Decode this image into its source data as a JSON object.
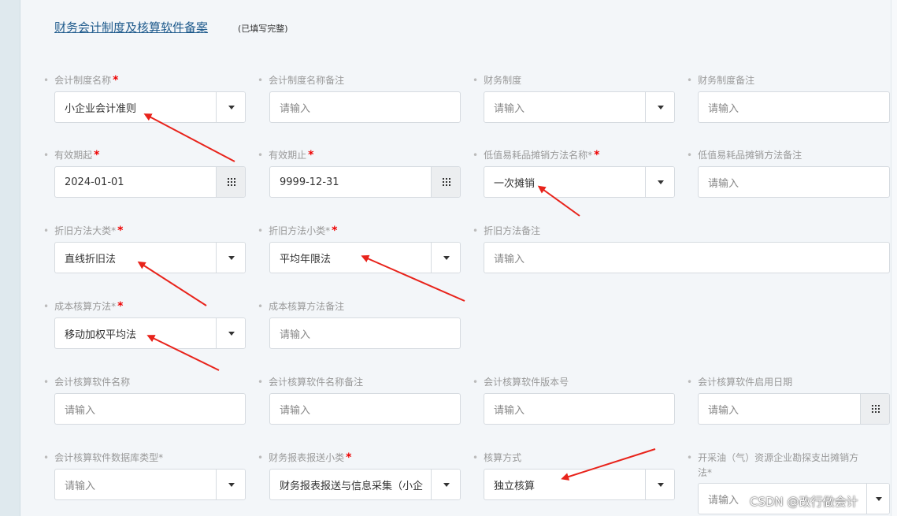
{
  "section": {
    "title": "财务会计制度及核算软件备案",
    "note": "(已填写完整)"
  },
  "fields": {
    "r1c1": {
      "label": "会计制度名称",
      "required": "*",
      "value": "小企业会计准则"
    },
    "r1c2": {
      "label": "会计制度名称备注",
      "placeholder": "请输入"
    },
    "r1c3": {
      "label": "财务制度",
      "placeholder": "请输入"
    },
    "r1c4": {
      "label": "财务制度备注",
      "placeholder": "请输入"
    },
    "r2c1": {
      "label": "有效期起",
      "required": "*",
      "value": "2024-01-01"
    },
    "r2c2": {
      "label": "有效期止",
      "required": "*",
      "value": "9999-12-31"
    },
    "r2c3": {
      "label": "低值易耗品摊销方法名称*",
      "required": "*",
      "value": "一次摊销"
    },
    "r2c4": {
      "label": "低值易耗品摊销方法备注",
      "placeholder": "请输入"
    },
    "r3c1": {
      "label": "折旧方法大类*",
      "required": "*",
      "value": "直线折旧法"
    },
    "r3c2": {
      "label": "折旧方法小类*",
      "required": "*",
      "value": "平均年限法"
    },
    "r3c3": {
      "label": "折旧方法备注",
      "placeholder": "请输入"
    },
    "r4c1": {
      "label": "成本核算方法*",
      "required": "*",
      "value": "移动加权平均法"
    },
    "r4c2": {
      "label": "成本核算方法备注",
      "placeholder": "请输入"
    },
    "r5c1": {
      "label": "会计核算软件名称",
      "placeholder": "请输入"
    },
    "r5c2": {
      "label": "会计核算软件名称备注",
      "placeholder": "请输入"
    },
    "r5c3": {
      "label": "会计核算软件版本号",
      "placeholder": "请输入"
    },
    "r5c4": {
      "label": "会计核算软件启用日期",
      "placeholder": "请输入"
    },
    "r6c1": {
      "label": "会计核算软件数据库类型*",
      "placeholder": "请输入"
    },
    "r6c2": {
      "label": "财务报表报送小类",
      "required": "*",
      "value": "财务报表报送与信息采集（小企"
    },
    "r6c3": {
      "label": "核算方式",
      "value": "独立核算"
    },
    "r6c4": {
      "label": "开采油（气）资源企业勘探支出摊销方",
      "label2": "法*",
      "placeholder": "请输入"
    }
  },
  "watermark": "CSDN @改行做会计",
  "colors": {
    "accent": "#1e5a8c",
    "required": "#e00000",
    "annotation_arrow": "#e8231b"
  }
}
